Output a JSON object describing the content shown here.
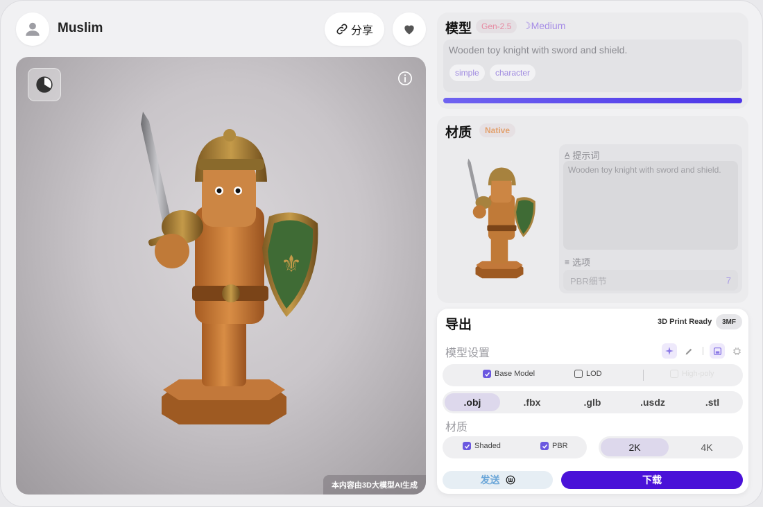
{
  "header": {
    "username": "Muslim",
    "share_label": "分享"
  },
  "viewer": {
    "watermark": "本内容由3D大模型AI生成"
  },
  "model_panel": {
    "title": "模型",
    "version_badge": "Gen-2.5",
    "quality_label": "Medium",
    "prompt": "Wooden toy knight with sword and shield.",
    "tags": [
      "simple",
      "character"
    ],
    "progress": 1.0
  },
  "material_panel": {
    "title": "材质",
    "badge": "Native",
    "prompt_label": "提示词",
    "prompt": "Wooden toy knight with sword and shield.",
    "options_label": "选项",
    "option_name": "PBR细节",
    "option_value": "7"
  },
  "export_panel": {
    "title": "导出",
    "print_ready": "3D Print Ready",
    "format_badge": "3MF",
    "model_settings_label": "模型设置",
    "model_options": [
      {
        "label": "Base Model",
        "checked": true
      },
      {
        "label": "LOD",
        "checked": false
      },
      {
        "label": "High-poly",
        "checked": false,
        "disabled": true
      }
    ],
    "formats": [
      ".obj",
      ".fbx",
      ".glb",
      ".usdz",
      ".stl"
    ],
    "selected_format": ".obj",
    "material_label": "材质",
    "material_options": [
      {
        "label": "Shaded",
        "checked": true
      },
      {
        "label": "PBR",
        "checked": true
      }
    ],
    "resolutions": [
      "2K",
      "4K"
    ],
    "selected_resolution": "2K",
    "send_label": "发送",
    "download_label": "下载"
  },
  "colors": {
    "accent": "#4a12d8",
    "progress_start": "#6f63f0",
    "progress_end": "#4d36e8",
    "tag_text": "#9f8ae0"
  }
}
